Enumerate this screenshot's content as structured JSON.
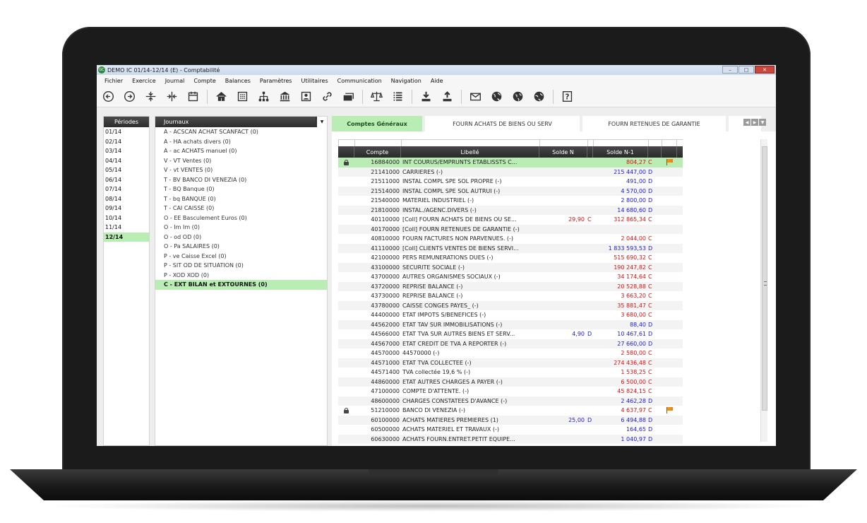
{
  "window": {
    "title": "DEMO IC 01/14-12/14 (E) - Comptabilité",
    "app_badge": "GC"
  },
  "menu": [
    "Fichier",
    "Exercice",
    "Journal",
    "Compte",
    "Balances",
    "Paramètres",
    "Utilitaires",
    "Communication",
    "Navigation",
    "Aide"
  ],
  "periods": {
    "header": "Périodes",
    "items": [
      "01/14",
      "02/14",
      "03/14",
      "04/14",
      "05/14",
      "06/14",
      "07/14",
      "08/14",
      "09/14",
      "10/14",
      "11/14",
      "12/14"
    ],
    "active": "12/14"
  },
  "journals": {
    "header": "Journaux",
    "items": [
      "A - ACSCAN ACHAT SCANFACT (0)",
      "A - HA achats divers (0)",
      "A - ac ACHATS manuel (0)",
      "V - VT Ventes (0)",
      "V - vt VENTES (0)",
      "T - BV BANCO DI VENEZIA (0)",
      "T - BQ Banque (0)",
      "T - bq BANQUE (0)",
      "T - CAI CAISSE (0)",
      "O - EE Basculement Euros (0)",
      "O - Im Im (0)",
      "O - od OD (0)",
      "O - Pa SALAIRES (0)",
      "P - ve Caisse Excel (0)",
      "P - SIT OD DE SITUATION (0)",
      "P - XOD XOD (0)",
      "C - EXT BILAN et EXTOURNES (0)"
    ],
    "active": "C - EXT BILAN et EXTOURNES (0)"
  },
  "tabs": [
    "Comptes Généraux",
    "FOURN ACHATS DE BIENS OU SERV",
    "FOURN RETENUES DE GARANTIE"
  ],
  "columns": {
    "compte": "Compte",
    "libelle": "Libellé",
    "solde_n": "Solde N",
    "solde_n1": "Solde N-1"
  },
  "colors": {
    "active_green": "#b9edb3",
    "credit": "#d41010",
    "debit": "#1a1ad0"
  },
  "accounts": [
    {
      "compte": "16884000",
      "libelle": "INT COURUS/EMPRUNTS ETABLISSTS C...",
      "sn": "",
      "snd": "",
      "sn1": "804,27",
      "sn1d": "C",
      "lock": true,
      "flag": true,
      "active": true
    },
    {
      "compte": "21141000",
      "libelle": "CARRIERES (-)",
      "sn": "",
      "snd": "",
      "sn1": "215 447,00",
      "sn1d": "D"
    },
    {
      "compte": "21511000",
      "libelle": "INSTAL COMPL SPE SOL PROPRE (-)",
      "sn": "",
      "snd": "",
      "sn1": "491,00",
      "sn1d": "D"
    },
    {
      "compte": "21514000",
      "libelle": "INSTAL COMPL SPE SOL AUTRUI (-)",
      "sn": "",
      "snd": "",
      "sn1": "4 570,00",
      "sn1d": "D"
    },
    {
      "compte": "21540000",
      "libelle": "MATERIEL INDUSTRIEL (-)",
      "sn": "",
      "snd": "",
      "sn1": "2 800,00",
      "sn1d": "D"
    },
    {
      "compte": "21810000",
      "libelle": "INSTAL./AGENC.DIVERS (-)",
      "sn": "",
      "snd": "",
      "sn1": "14 680,60",
      "sn1d": "D"
    },
    {
      "compte": "40110000",
      "libelle": "[Coll] FOURN ACHATS DE BIENS OU SE...",
      "sn": "29,90",
      "snd": "C",
      "sn1": "312 865,34",
      "sn1d": "C"
    },
    {
      "compte": "40170000",
      "libelle": "[Coll] FOURN RETENUES DE GARANTIE (-)",
      "sn": "",
      "snd": "",
      "sn1": "",
      "sn1d": ""
    },
    {
      "compte": "40810000",
      "libelle": "FOURN FACTURES NON PARVENUES. (-)",
      "sn": "",
      "snd": "",
      "sn1": "2 044,00",
      "sn1d": "C"
    },
    {
      "compte": "41110000",
      "libelle": "[Coll] CLIENTS VENTES DE BIENS SERVI...",
      "sn": "",
      "snd": "",
      "sn1": "1 833 593,53",
      "sn1d": "D"
    },
    {
      "compte": "42100000",
      "libelle": "PERS REMUNERATIONS DUES (-)",
      "sn": "",
      "snd": "",
      "sn1": "515 690,32",
      "sn1d": "C"
    },
    {
      "compte": "43100000",
      "libelle": "SECURITE SOCIALE (-)",
      "sn": "",
      "snd": "",
      "sn1": "190 247,82",
      "sn1d": "C"
    },
    {
      "compte": "43700000",
      "libelle": "AUTRES ORGANISMES SOCIAUX (-)",
      "sn": "",
      "snd": "",
      "sn1": "34 174,64",
      "sn1d": "C"
    },
    {
      "compte": "43720000",
      "libelle": "REPRISE BALANCE (-)",
      "sn": "",
      "snd": "",
      "sn1": "20 528,88",
      "sn1d": "C"
    },
    {
      "compte": "43730000",
      "libelle": "REPRISE BALANCE (-)",
      "sn": "",
      "snd": "",
      "sn1": "3 663,20",
      "sn1d": "C"
    },
    {
      "compte": "43780000",
      "libelle": "CAISSE CONGES PAYES_ (-)",
      "sn": "",
      "snd": "",
      "sn1": "35 881,47",
      "sn1d": "C"
    },
    {
      "compte": "44400000",
      "libelle": "ETAT IMPOTS S/BENEFICES (-)",
      "sn": "",
      "snd": "",
      "sn1": "3 680,00",
      "sn1d": "C"
    },
    {
      "compte": "44562000",
      "libelle": "ETAT TAV SUR IMMOBILISATIONS (-)",
      "sn": "",
      "snd": "",
      "sn1": "88,40",
      "sn1d": "D"
    },
    {
      "compte": "44566000",
      "libelle": "ETAT TVA SUR AUTRES BIENS ET SERV...",
      "sn": "4,90",
      "snd": "D",
      "sn1": "10 467,61",
      "sn1d": "D"
    },
    {
      "compte": "44567000",
      "libelle": "ETAT CREDIT DE TVA A REPORTER (-)",
      "sn": "",
      "snd": "",
      "sn1": "27 660,00",
      "sn1d": "D"
    },
    {
      "compte": "44570000",
      "libelle": "44570000 (-)",
      "sn": "",
      "snd": "",
      "sn1": "2 580,00",
      "sn1d": "C"
    },
    {
      "compte": "44571000",
      "libelle": "ETAT TVA COLLECTEE (-)",
      "sn": "",
      "snd": "",
      "sn1": "274 436,48",
      "sn1d": "C"
    },
    {
      "compte": "44571400",
      "libelle": "TVA collectée 19,6 % (-)",
      "sn": "",
      "snd": "",
      "sn1": "1 538,25",
      "sn1d": "C"
    },
    {
      "compte": "44860000",
      "libelle": "ETAT AUTRES CHARGES A PAYER (-)",
      "sn": "",
      "snd": "",
      "sn1": "6 500,00",
      "sn1d": "C"
    },
    {
      "compte": "47100000",
      "libelle": "COMPTE D'ATTENTE. (-)",
      "sn": "",
      "snd": "",
      "sn1": "45 824,15",
      "sn1d": "C"
    },
    {
      "compte": "48600000",
      "libelle": "CHARGES CONSTATEES D'AVANCE (-)",
      "sn": "",
      "snd": "",
      "sn1": "2 462,28",
      "sn1d": "D"
    },
    {
      "compte": "51210000",
      "libelle": "BANCO DI VENEZIA (-)",
      "sn": "",
      "snd": "",
      "sn1": "4 637,97",
      "sn1d": "C",
      "lock": true,
      "flag": true
    },
    {
      "compte": "60100000",
      "libelle": "ACHATS MATIERES PREMIERES (1)",
      "sn": "25,00",
      "snd": "D",
      "sn1": "6 494,88",
      "sn1d": "D"
    },
    {
      "compte": "60500000",
      "libelle": "ACHATS MATERIEL ET TRAVAUX (-)",
      "sn": "",
      "snd": "",
      "sn1": "164,65",
      "sn1d": "D"
    },
    {
      "compte": "60630000",
      "libelle": "ACHATS FOURN.ENTRET.PETIT EQUIPE...",
      "sn": "",
      "snd": "",
      "sn1": "1 040,97",
      "sn1d": "D"
    }
  ]
}
